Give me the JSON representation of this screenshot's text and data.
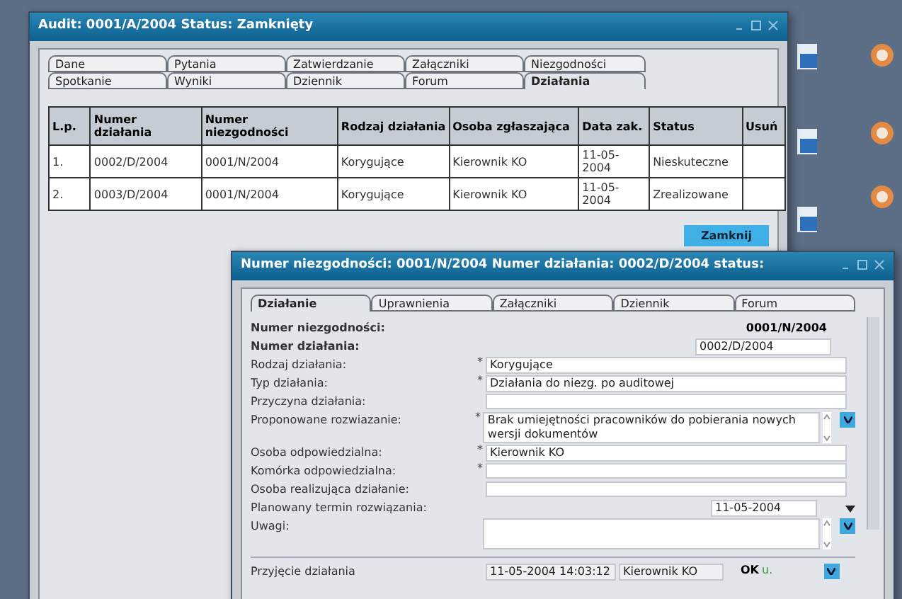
{
  "audit_window": {
    "title": "Audit: 0001/A/2004 Status: Zamknięty",
    "tab_rows": [
      [
        {
          "label": "Dane",
          "selected": false
        },
        {
          "label": "Pytania",
          "selected": false
        },
        {
          "label": "Zatwierdzanie",
          "selected": false
        },
        {
          "label": "Załączniki",
          "selected": false
        },
        {
          "label": "Niezgodności",
          "selected": false
        }
      ],
      [
        {
          "label": "Spotkanie",
          "selected": false
        },
        {
          "label": "Wyniki",
          "selected": false
        },
        {
          "label": "Dziennik",
          "selected": false
        },
        {
          "label": "Forum",
          "selected": false
        },
        {
          "label": "Działania",
          "selected": true
        }
      ]
    ],
    "table": {
      "columns": [
        "L.p.",
        "Numer działania",
        "Numer niezgodności",
        "Rodzaj działania",
        "Osoba zgłaszająca",
        "Data zak.",
        "Status",
        "Usuń"
      ],
      "rows": [
        [
          "1.",
          "0002/D/2004",
          "0001/N/2004",
          "Korygujące",
          "Kierownik KO",
          "11-05-2004",
          "Nieskuteczne"
        ],
        [
          "2.",
          "0003/D/2004",
          "0001/N/2004",
          "Korygujące",
          "Kierownik KO",
          "11-05-2004",
          "Zrealizowane"
        ]
      ]
    },
    "close_button": "Zamknij"
  },
  "action_window": {
    "title": "Numer niezgodności: 0001/N/2004 Numer działania: 0002/D/2004 status:",
    "tabs": [
      {
        "label": "Działanie",
        "selected": true
      },
      {
        "label": "Uprawnienia",
        "selected": false
      },
      {
        "label": "Załączniki",
        "selected": false
      },
      {
        "label": "Dziennik",
        "selected": false
      },
      {
        "label": "Forum",
        "selected": false
      }
    ],
    "fields": [
      {
        "kind": "info",
        "label": "Numer niezgodności:",
        "value": "0001/N/2004"
      },
      {
        "kind": "short",
        "label": "Numer działania:",
        "value": "0002/D/2004"
      },
      {
        "kind": "field",
        "label": "Rodzaj działania:",
        "value": "Korygujące",
        "required_mark": "*"
      },
      {
        "kind": "field",
        "label": "Typ działania:",
        "value": "Działania do niezg. po auditowej",
        "required_mark": "*"
      },
      {
        "kind": "field",
        "label": "Przyczyna działania:"
      },
      {
        "kind": "memo",
        "label": "Proponowane rozwiazanie:",
        "value": "Brak umiejętności pracowników do pobierania nowych wersji dokumentów",
        "required_mark": "*"
      },
      {
        "kind": "field",
        "label": "Osoba odpowiedzialna:",
        "value": "Kierownik KO",
        "required_mark": "*"
      },
      {
        "kind": "field",
        "label": "Komórka odpowiedzialna:",
        "required_mark": "*"
      },
      {
        "kind": "field",
        "label": "Osoba realizująca działanie:"
      },
      {
        "kind": "date",
        "label": "Planowany termin rozwiązania:",
        "value": "11-05-2004"
      },
      {
        "kind": "memo",
        "label": "Uwagi:"
      }
    ],
    "acceptance": {
      "label": "Przyjęcie działania",
      "date": "11-05-2004 14:03:12",
      "person": "Kierownik KO",
      "status": "OK",
      "mark": "u."
    }
  }
}
